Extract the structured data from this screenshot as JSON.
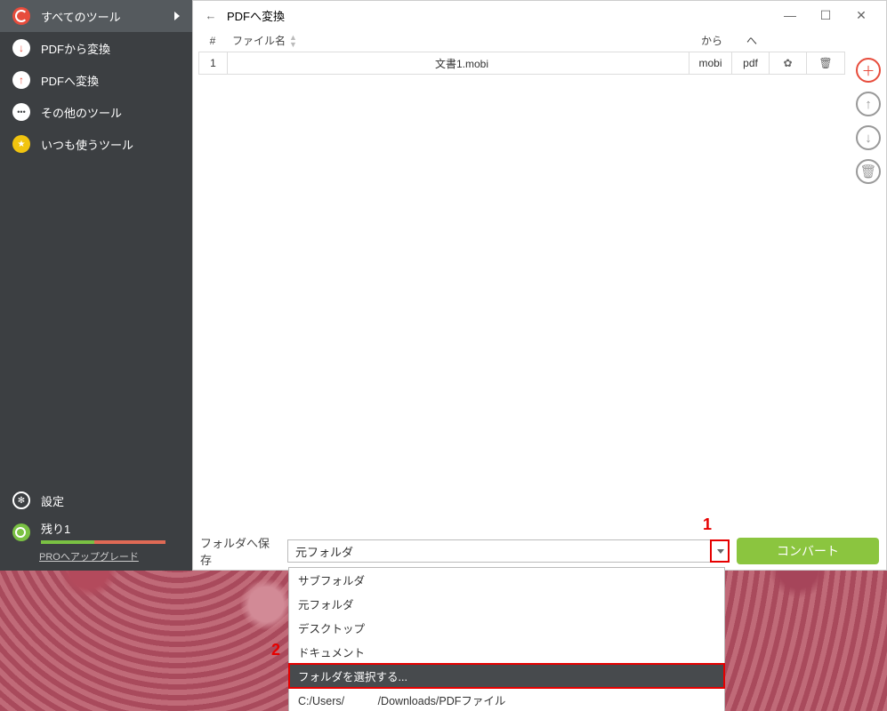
{
  "sidebar": {
    "items": [
      {
        "label": "すべてのツール",
        "icon": "swirl",
        "active": true
      },
      {
        "label": "PDFから変換",
        "icon": "arrow-down"
      },
      {
        "label": "PDFへ変換",
        "icon": "arrow-up"
      },
      {
        "label": "その他のツール",
        "icon": "dots"
      },
      {
        "label": "いつも使うツール",
        "icon": "star"
      }
    ],
    "settings_label": "設定",
    "remaining_label": "残り1",
    "upgrade_label": "PROへアップグレード"
  },
  "header": {
    "title": "PDFへ変換"
  },
  "table": {
    "columns": {
      "num": "#",
      "name": "ファイル名",
      "from": "から",
      "to": "へ"
    },
    "rows": [
      {
        "num": "1",
        "name": "文書1.mobi",
        "from": "mobi",
        "to": "pdf"
      }
    ]
  },
  "bottom": {
    "label": "フォルダへ保存",
    "selected": "元フォルダ",
    "convert_label": "コンバート",
    "options": [
      "サブフォルダ",
      "元フォルダ",
      "デスクトップ",
      "ドキュメント",
      "フォルダを選択する...",
      "C:/Users/　　　/Downloads/PDFファイル"
    ]
  },
  "annotations": {
    "one": "1",
    "two": "2"
  }
}
